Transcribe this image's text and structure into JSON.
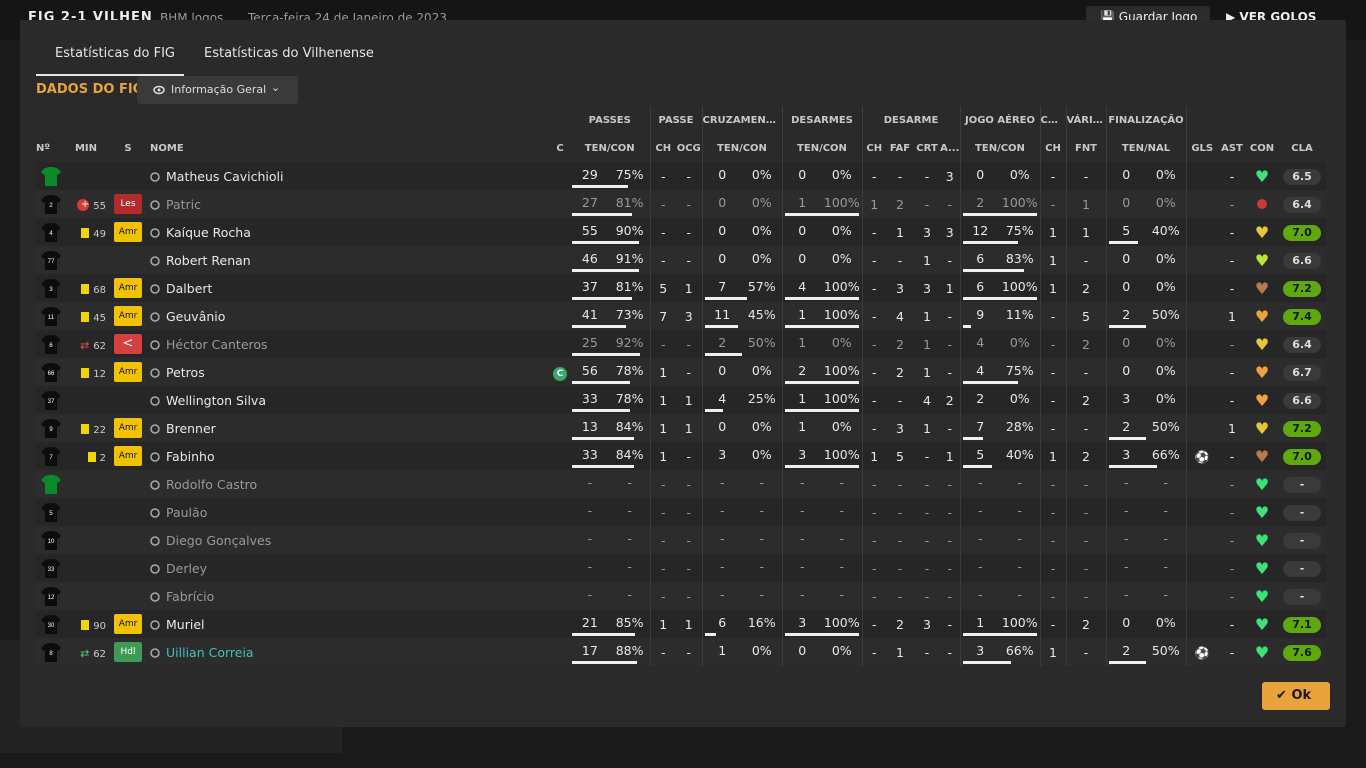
{
  "topbar": {
    "match": "FIG 2-1 VILHEN",
    "stadium": "BHM logos",
    "date": "Terça-feira 24 de Janeiro de 2023",
    "save_label": "Guardar Jogo",
    "goals_label": "VER GOLOS"
  },
  "tabs": [
    {
      "label": "Estatísticas do FIG",
      "active": true
    },
    {
      "label": "Estatísticas do Vilhenense",
      "active": false
    }
  ],
  "section_title": "DADOS DO FIG",
  "info_button": {
    "label": "Informação Geral"
  },
  "groups": [
    "PASSES",
    "PASSE",
    "CRUZAMENTOS",
    "DESARMES",
    "DESARME",
    "JOGO AÉREO",
    "CA...",
    "VÁRIOS",
    "FINALIZAÇÃO"
  ],
  "headers": [
    "Nº",
    "MIN",
    "S",
    "NOME",
    "C",
    "TEN/CON",
    "CH",
    "OCG",
    "TEN/CON",
    "TEN/CON",
    "CH",
    "FAF",
    "CRT",
    "A...",
    "TEN/CON",
    "CH",
    "FNT",
    "TEN/NAL",
    "GLS",
    "AST",
    "CON",
    "CLA"
  ],
  "players": [
    {
      "num": "",
      "min": "",
      "status": "",
      "name": "Matheus Cavichioli",
      "cap": "",
      "shirt": "gk",
      "event": "",
      "pa": "29",
      "pp": "75%",
      "pf": 0.75,
      "pch": "-",
      "pocg": "-",
      "ca": "0",
      "cp": "0%",
      "cf": 0,
      "da": "0",
      "dp": "0%",
      "df": 0,
      "dch": "-",
      "dfaf": "-",
      "dcrt": "-",
      "da2": "3",
      "aa": "0",
      "ap": "0%",
      "af": 0,
      "ca2": "-",
      "fnt": "-",
      "fa": "0",
      "fp": "0%",
      "ff": 0,
      "gls": "",
      "ast": "-",
      "con": "green",
      "cla": "6.5",
      "clag": false,
      "dim": false,
      "teal": false
    },
    {
      "num": "2",
      "min": "55",
      "status": "Les",
      "name": "Patric",
      "cap": "",
      "shirt": "black",
      "event": "injury",
      "pa": "27",
      "pp": "81%",
      "pf": 0.81,
      "pch": "-",
      "pocg": "-",
      "ca": "0",
      "cp": "0%",
      "cf": 0,
      "da": "1",
      "dp": "100%",
      "df": 1,
      "dch": "1",
      "dfaf": "2",
      "dcrt": "-",
      "da2": "-",
      "aa": "2",
      "ap": "100%",
      "af": 1,
      "ca2": "-",
      "fnt": "1",
      "fa": "0",
      "fp": "0%",
      "ff": 0,
      "gls": "",
      "ast": "-",
      "con": "injured",
      "cla": "6.4",
      "clag": false,
      "dim": true,
      "teal": false
    },
    {
      "num": "4",
      "min": "49",
      "status": "Amr",
      "name": "Kaíque Rocha",
      "cap": "",
      "shirt": "black",
      "event": "yellow",
      "pa": "55",
      "pp": "90%",
      "pf": 0.9,
      "pch": "-",
      "pocg": "-",
      "ca": "0",
      "cp": "0%",
      "cf": 0,
      "da": "0",
      "dp": "0%",
      "df": 0,
      "dch": "-",
      "dfaf": "1",
      "dcrt": "3",
      "da2": "3",
      "aa": "12",
      "ap": "75%",
      "af": 0.75,
      "ca2": "1",
      "fnt": "1",
      "fa": "5",
      "fp": "40%",
      "ff": 0.4,
      "gls": "",
      "ast": "-",
      "con": "yellow",
      "cla": "7.0",
      "clag": true,
      "dim": false,
      "teal": false
    },
    {
      "num": "77",
      "min": "",
      "status": "",
      "name": "Robert Renan",
      "cap": "",
      "shirt": "black",
      "event": "",
      "pa": "46",
      "pp": "91%",
      "pf": 0.91,
      "pch": "-",
      "pocg": "-",
      "ca": "0",
      "cp": "0%",
      "cf": 0,
      "da": "0",
      "dp": "0%",
      "df": 0,
      "dch": "-",
      "dfaf": "-",
      "dcrt": "1",
      "da2": "-",
      "aa": "6",
      "ap": "83%",
      "af": 0.83,
      "ca2": "1",
      "fnt": "-",
      "fa": "0",
      "fp": "0%",
      "ff": 0,
      "gls": "",
      "ast": "-",
      "con": "lime",
      "cla": "6.6",
      "clag": false,
      "dim": false,
      "teal": false
    },
    {
      "num": "3",
      "min": "68",
      "status": "Amr",
      "name": "Dalbert",
      "cap": "",
      "shirt": "black",
      "event": "yellow",
      "pa": "37",
      "pp": "81%",
      "pf": 0.81,
      "pch": "5",
      "pocg": "1",
      "ca": "7",
      "cp": "57%",
      "cf": 0.57,
      "da": "4",
      "dp": "100%",
      "df": 1,
      "dch": "-",
      "dfaf": "3",
      "dcrt": "3",
      "da2": "1",
      "aa": "6",
      "ap": "100%",
      "af": 1,
      "ca2": "1",
      "fnt": "2",
      "fa": "0",
      "fp": "0%",
      "ff": 0,
      "gls": "",
      "ast": "-",
      "con": "brown",
      "cla": "7.2",
      "clag": true,
      "dim": false,
      "teal": false
    },
    {
      "num": "11",
      "min": "45",
      "status": "Amr",
      "name": "Geuvânio",
      "cap": "",
      "shirt": "black",
      "event": "yellow",
      "pa": "41",
      "pp": "73%",
      "pf": 0.73,
      "pch": "7",
      "pocg": "3",
      "ca": "11",
      "cp": "45%",
      "cf": 0.45,
      "da": "1",
      "dp": "100%",
      "df": 1,
      "dch": "-",
      "dfaf": "4",
      "dcrt": "1",
      "da2": "-",
      "aa": "9",
      "ap": "11%",
      "af": 0.11,
      "ca2": "-",
      "fnt": "5",
      "fa": "2",
      "fp": "50%",
      "ff": 0.5,
      "gls": "",
      "ast": "1",
      "con": "orange",
      "cla": "7.4",
      "clag": true,
      "dim": false,
      "teal": false
    },
    {
      "num": "6",
      "min": "62",
      "status": "<",
      "name": "Héctor Canteros",
      "cap": "",
      "shirt": "black",
      "event": "subout",
      "pa": "25",
      "pp": "92%",
      "pf": 0.92,
      "pch": "-",
      "pocg": "-",
      "ca": "2",
      "cp": "50%",
      "cf": 0.5,
      "da": "1",
      "dp": "0%",
      "df": 0,
      "dch": "-",
      "dfaf": "2",
      "dcrt": "1",
      "da2": "-",
      "aa": "4",
      "ap": "0%",
      "af": 0,
      "ca2": "-",
      "fnt": "2",
      "fa": "0",
      "fp": "0%",
      "ff": 0,
      "gls": "",
      "ast": "-",
      "con": "yellow",
      "cla": "6.4",
      "clag": false,
      "dim": true,
      "teal": false
    },
    {
      "num": "66",
      "min": "12",
      "status": "Amr",
      "name": "Petros",
      "cap": "C",
      "shirt": "black",
      "event": "yellow",
      "pa": "56",
      "pp": "78%",
      "pf": 0.78,
      "pch": "1",
      "pocg": "-",
      "ca": "0",
      "cp": "0%",
      "cf": 0,
      "da": "2",
      "dp": "100%",
      "df": 1,
      "dch": "-",
      "dfaf": "2",
      "dcrt": "1",
      "da2": "-",
      "aa": "4",
      "ap": "75%",
      "af": 0.75,
      "ca2": "-",
      "fnt": "-",
      "fa": "0",
      "fp": "0%",
      "ff": 0,
      "gls": "",
      "ast": "-",
      "con": "orange",
      "cla": "6.7",
      "clag": false,
      "dim": false,
      "teal": false
    },
    {
      "num": "37",
      "min": "",
      "status": "",
      "name": "Wellington Silva",
      "cap": "",
      "shirt": "black",
      "event": "",
      "pa": "33",
      "pp": "78%",
      "pf": 0.78,
      "pch": "1",
      "pocg": "1",
      "ca": "4",
      "cp": "25%",
      "cf": 0.25,
      "da": "1",
      "dp": "100%",
      "df": 1,
      "dch": "-",
      "dfaf": "-",
      "dcrt": "4",
      "da2": "2",
      "aa": "2",
      "ap": "0%",
      "af": 0,
      "ca2": "-",
      "fnt": "2",
      "fa": "3",
      "fp": "0%",
      "ff": 0,
      "gls": "",
      "ast": "-",
      "con": "orange",
      "cla": "6.6",
      "clag": false,
      "dim": false,
      "teal": false
    },
    {
      "num": "9",
      "min": "22",
      "status": "Amr",
      "name": "Brenner",
      "cap": "",
      "shirt": "black",
      "event": "yellow",
      "pa": "13",
      "pp": "84%",
      "pf": 0.84,
      "pch": "1",
      "pocg": "1",
      "ca": "0",
      "cp": "0%",
      "cf": 0,
      "da": "1",
      "dp": "0%",
      "df": 0,
      "dch": "-",
      "dfaf": "3",
      "dcrt": "1",
      "da2": "-",
      "aa": "7",
      "ap": "28%",
      "af": 0.28,
      "ca2": "-",
      "fnt": "-",
      "fa": "2",
      "fp": "50%",
      "ff": 0.5,
      "gls": "",
      "ast": "1",
      "con": "yellow",
      "cla": "7.2",
      "clag": true,
      "dim": false,
      "teal": false
    },
    {
      "num": "7",
      "min": "2",
      "status": "Amr",
      "name": "Fabinho",
      "cap": "",
      "shirt": "black",
      "event": "yellow",
      "pa": "33",
      "pp": "84%",
      "pf": 0.84,
      "pch": "1",
      "pocg": "-",
      "ca": "3",
      "cp": "0%",
      "cf": 0,
      "da": "3",
      "dp": "100%",
      "df": 1,
      "dch": "1",
      "dfaf": "5",
      "dcrt": "-",
      "da2": "1",
      "aa": "5",
      "ap": "40%",
      "af": 0.4,
      "ca2": "1",
      "fnt": "2",
      "fa": "3",
      "fp": "66%",
      "ff": 0.66,
      "gls": "ball",
      "ast": "-",
      "con": "brown",
      "cla": "7.0",
      "clag": true,
      "dim": false,
      "teal": false
    },
    {
      "num": "",
      "min": "",
      "status": "",
      "name": "Rodolfo Castro",
      "cap": "",
      "shirt": "gk",
      "event": "",
      "pa": "-",
      "pp": "-",
      "pf": 0,
      "pch": "-",
      "pocg": "-",
      "ca": "-",
      "cp": "-",
      "cf": 0,
      "da": "-",
      "dp": "-",
      "df": 0,
      "dch": "-",
      "dfaf": "-",
      "dcrt": "-",
      "da2": "-",
      "aa": "-",
      "ap": "-",
      "af": 0,
      "ca2": "-",
      "fnt": "-",
      "fa": "-",
      "fp": "-",
      "ff": 0,
      "gls": "",
      "ast": "-",
      "con": "green",
      "cla": "-",
      "clag": false,
      "dim": true,
      "teal": false
    },
    {
      "num": "5",
      "min": "",
      "status": "",
      "name": "Paulão",
      "cap": "",
      "shirt": "black",
      "event": "",
      "pa": "-",
      "pp": "-",
      "pf": 0,
      "pch": "-",
      "pocg": "-",
      "ca": "-",
      "cp": "-",
      "cf": 0,
      "da": "-",
      "dp": "-",
      "df": 0,
      "dch": "-",
      "dfaf": "-",
      "dcrt": "-",
      "da2": "-",
      "aa": "-",
      "ap": "-",
      "af": 0,
      "ca2": "-",
      "fnt": "-",
      "fa": "-",
      "fp": "-",
      "ff": 0,
      "gls": "",
      "ast": "-",
      "con": "green",
      "cla": "-",
      "clag": false,
      "dim": true,
      "teal": false
    },
    {
      "num": "10",
      "min": "",
      "status": "",
      "name": "Diego Gonçalves",
      "cap": "",
      "shirt": "black",
      "event": "",
      "pa": "-",
      "pp": "-",
      "pf": 0,
      "pch": "-",
      "pocg": "-",
      "ca": "-",
      "cp": "-",
      "cf": 0,
      "da": "-",
      "dp": "-",
      "df": 0,
      "dch": "-",
      "dfaf": "-",
      "dcrt": "-",
      "da2": "-",
      "aa": "-",
      "ap": "-",
      "af": 0,
      "ca2": "-",
      "fnt": "-",
      "fa": "-",
      "fp": "-",
      "ff": 0,
      "gls": "",
      "ast": "-",
      "con": "green",
      "cla": "-",
      "clag": false,
      "dim": true,
      "teal": false
    },
    {
      "num": "33",
      "min": "",
      "status": "",
      "name": "Derley",
      "cap": "",
      "shirt": "black",
      "event": "",
      "pa": "-",
      "pp": "-",
      "pf": 0,
      "pch": "-",
      "pocg": "-",
      "ca": "-",
      "cp": "-",
      "cf": 0,
      "da": "-",
      "dp": "-",
      "df": 0,
      "dch": "-",
      "dfaf": "-",
      "dcrt": "-",
      "da2": "-",
      "aa": "-",
      "ap": "-",
      "af": 0,
      "ca2": "-",
      "fnt": "-",
      "fa": "-",
      "fp": "-",
      "ff": 0,
      "gls": "",
      "ast": "-",
      "con": "green",
      "cla": "-",
      "clag": false,
      "dim": true,
      "teal": false
    },
    {
      "num": "12",
      "min": "",
      "status": "",
      "name": "Fabrício",
      "cap": "",
      "shirt": "black",
      "event": "",
      "pa": "-",
      "pp": "-",
      "pf": 0,
      "pch": "-",
      "pocg": "-",
      "ca": "-",
      "cp": "-",
      "cf": 0,
      "da": "-",
      "dp": "-",
      "df": 0,
      "dch": "-",
      "dfaf": "-",
      "dcrt": "-",
      "da2": "-",
      "aa": "-",
      "ap": "-",
      "af": 0,
      "ca2": "-",
      "fnt": "-",
      "fa": "-",
      "fp": "-",
      "ff": 0,
      "gls": "",
      "ast": "-",
      "con": "green",
      "cla": "-",
      "clag": false,
      "dim": true,
      "teal": false
    },
    {
      "num": "30",
      "min": "90",
      "status": "Amr",
      "name": "Muriel",
      "cap": "",
      "shirt": "black",
      "event": "yellow",
      "pa": "21",
      "pp": "85%",
      "pf": 0.85,
      "pch": "1",
      "pocg": "1",
      "ca": "6",
      "cp": "16%",
      "cf": 0.16,
      "da": "3",
      "dp": "100%",
      "df": 1,
      "dch": "-",
      "dfaf": "2",
      "dcrt": "3",
      "da2": "-",
      "aa": "1",
      "ap": "100%",
      "af": 1,
      "ca2": "-",
      "fnt": "2",
      "fa": "0",
      "fp": "0%",
      "ff": 0,
      "gls": "",
      "ast": "-",
      "con": "green",
      "cla": "7.1",
      "clag": true,
      "dim": false,
      "teal": false
    },
    {
      "num": "8",
      "min": "62",
      "status": "Hdl",
      "name": "Uillian Correia",
      "cap": "",
      "shirt": "black",
      "event": "subin",
      "pa": "17",
      "pp": "88%",
      "pf": 0.88,
      "pch": "-",
      "pocg": "-",
      "ca": "1",
      "cp": "0%",
      "cf": 0,
      "da": "0",
      "dp": "0%",
      "df": 0,
      "dch": "-",
      "dfaf": "1",
      "dcrt": "-",
      "da2": "-",
      "aa": "3",
      "ap": "66%",
      "af": 0.66,
      "ca2": "1",
      "fnt": "-",
      "fa": "2",
      "fp": "50%",
      "ff": 0.5,
      "gls": "ball",
      "ast": "-",
      "con": "green",
      "cla": "7.6",
      "clag": true,
      "dim": false,
      "teal": true
    }
  ],
  "ok_label": "Ok"
}
